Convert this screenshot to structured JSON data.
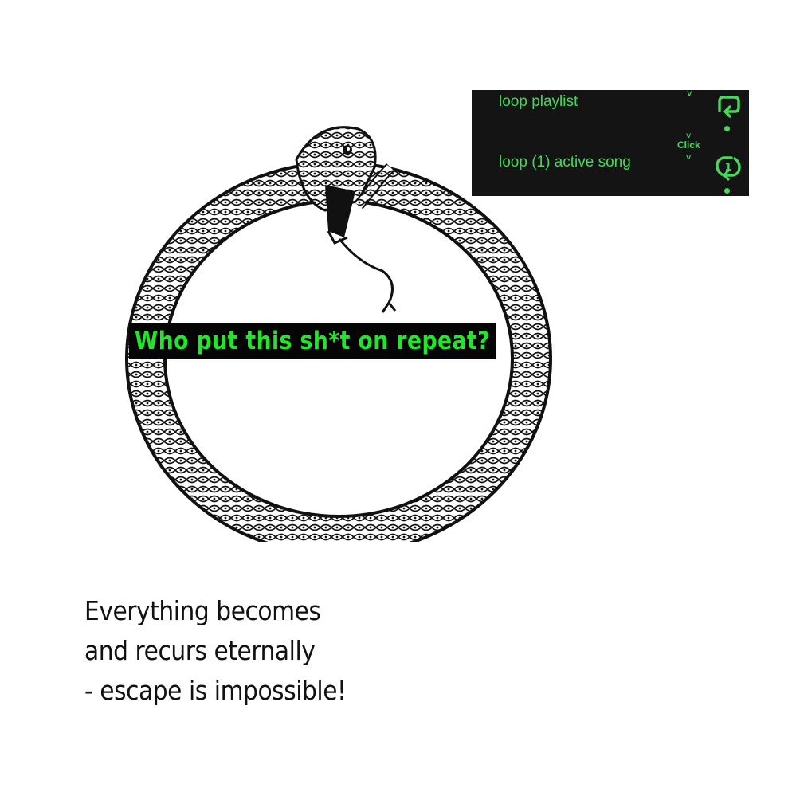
{
  "headline": {
    "text": "Who put this sh*t on repeat?"
  },
  "repeat_menu": {
    "items": [
      {
        "label": "loop playlist",
        "icon": "repeat-icon"
      },
      {
        "label": "loop (1) active song",
        "icon": "repeat-one-icon"
      }
    ],
    "click_note": "Click",
    "accent_color": "#45d95a",
    "background_color": "#141414"
  },
  "caption": {
    "lines": [
      "Everything becomes",
      "and recurs eternally",
      "- escape is impossible!"
    ]
  },
  "illustration": {
    "subject": "ouroboros-icon"
  }
}
